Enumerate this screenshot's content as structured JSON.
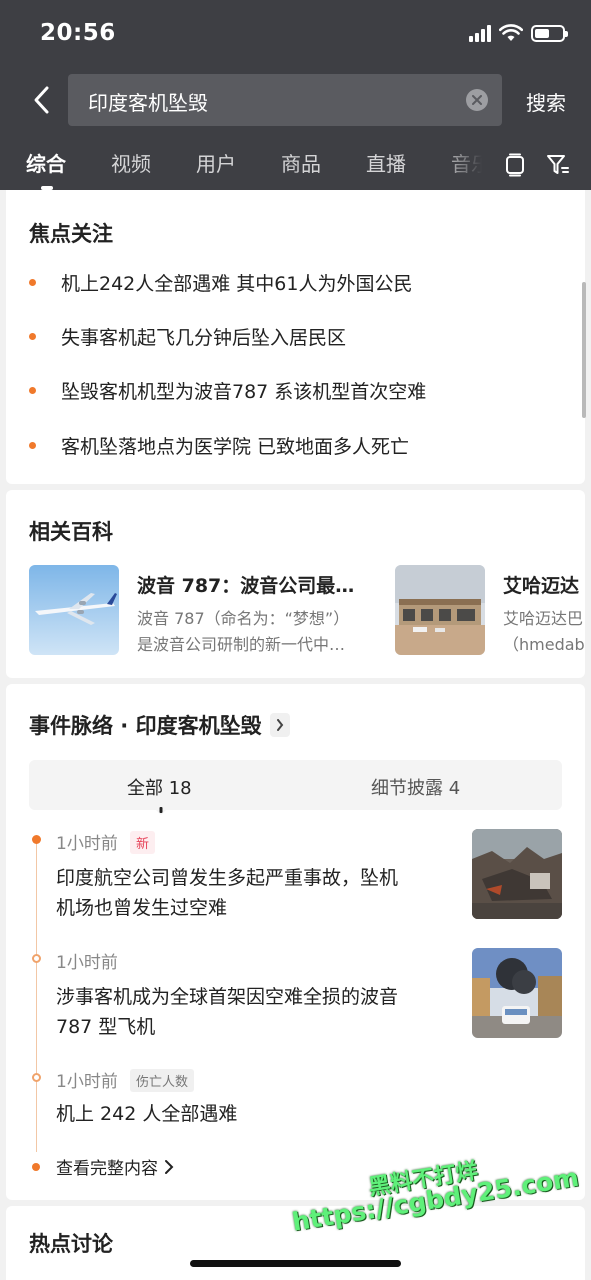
{
  "status_bar": {
    "time": "20:56"
  },
  "search": {
    "query": "印度客机坠毁",
    "button_label": "搜索"
  },
  "tabs": [
    {
      "label": "综合",
      "active": true
    },
    {
      "label": "视频"
    },
    {
      "label": "用户"
    },
    {
      "label": "商品"
    },
    {
      "label": "直播"
    },
    {
      "label": "音乐"
    }
  ],
  "focus": {
    "title": "焦点关注",
    "items": [
      "机上242人全部遇难 其中61人为外国公民",
      "失事客机起飞几分钟后坠入居民区",
      "坠毁客机机型为波音787 系该机型首次空难",
      "客机坠落地点为医学院 已致地面多人死亡"
    ]
  },
  "encyclopedia": {
    "title": "相关百科",
    "items": [
      {
        "title": "波音 787：波音公司最…",
        "line1": "波音 787（命名为：“梦想”）",
        "line2": "是波音公司研制的新一代中…"
      },
      {
        "title": "艾哈迈达",
        "line1": "艾哈迈达巴",
        "line2": "（hmedaba"
      }
    ]
  },
  "timeline": {
    "title": "事件脉络 · 印度客机坠毁",
    "segments": [
      "全部 18",
      "细节披露 4"
    ],
    "items": [
      {
        "time": "1小时前",
        "badge": "新",
        "text": [
          "印度航空公司曾发生多起严重事故，坠机",
          "机场也曾发生过空难"
        ]
      },
      {
        "time": "1小时前",
        "badge": "",
        "text": [
          "涉事客机成为全球首架因空难全损的波音",
          "787 型飞机"
        ]
      },
      {
        "time": "1小时前",
        "badge": "伤亡人数",
        "text": [
          "机上 242 人全部遇难"
        ]
      }
    ],
    "more_label": "查看完整内容"
  },
  "hot": {
    "title": "热点讨论"
  },
  "watermark": {
    "line1": "黑料不打烊",
    "line2": "https://cgbdy25.com"
  },
  "colors": {
    "header_bg": "#3e3f44",
    "accent_orange": "#f0792b",
    "new_badge": "#e7445a"
  }
}
